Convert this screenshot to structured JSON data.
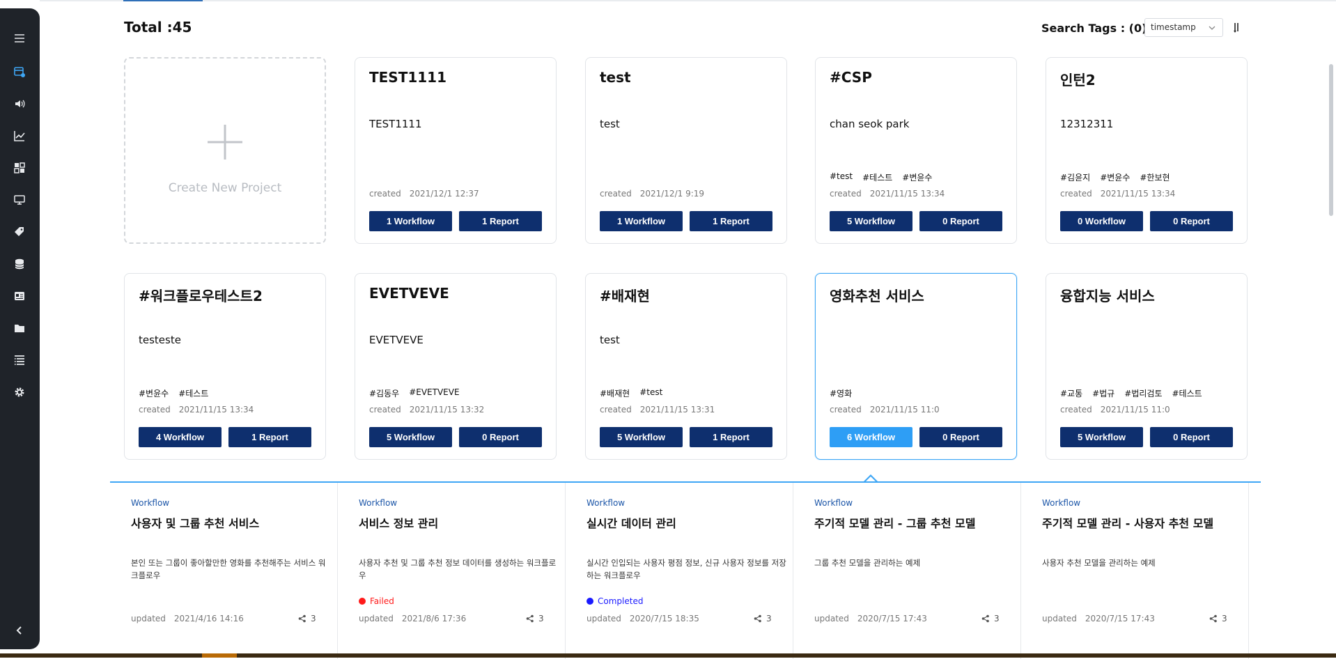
{
  "header": {
    "total_label": "Total :45",
    "search_tags_label": "Search Tags : (0)",
    "sort_value": "timestamp"
  },
  "create_card": {
    "label": "Create New Project"
  },
  "projects": [
    {
      "title": "TEST1111",
      "desc": "TEST1111",
      "tags": [],
      "created_label": "created",
      "created": "2021/12/1 12:37",
      "workflow_btn": "1 Workflow",
      "report_btn": "1 Report"
    },
    {
      "title": "test",
      "desc": "test",
      "tags": [],
      "created_label": "created",
      "created": "2021/12/1 9:19",
      "workflow_btn": "1 Workflow",
      "report_btn": "1 Report"
    },
    {
      "title": "#CSP",
      "desc": "chan seok park",
      "tags": [
        "#test",
        "#테스트",
        "#변윤수"
      ],
      "created_label": "created",
      "created": "2021/11/15 13:34",
      "workflow_btn": "5 Workflow",
      "report_btn": "0 Report"
    },
    {
      "title": "인턴2",
      "desc": "12312311",
      "tags": [
        "#김윤지",
        "#변윤수",
        "#한보현"
      ],
      "created_label": "created",
      "created": "2021/11/15 13:34",
      "workflow_btn": "0 Workflow",
      "report_btn": "0 Report"
    },
    {
      "title": "#워크플로우테스트2",
      "desc": "testeste",
      "tags": [
        "#변윤수",
        "#테스트"
      ],
      "created_label": "created",
      "created": "2021/11/15 13:34",
      "workflow_btn": "4 Workflow",
      "report_btn": "1 Report"
    },
    {
      "title": "EVETVEVE",
      "desc": "EVETVEVE",
      "tags": [
        "#김동우",
        "#EVETVEVE"
      ],
      "created_label": "created",
      "created": "2021/11/15 13:32",
      "workflow_btn": "5 Workflow",
      "report_btn": "0 Report"
    },
    {
      "title": "#배재현",
      "desc": "test",
      "tags": [
        "#배재현",
        "#test"
      ],
      "created_label": "created",
      "created": "2021/11/15 13:31",
      "workflow_btn": "5 Workflow",
      "report_btn": "1 Report"
    },
    {
      "title": "영화추천 서비스",
      "desc": "",
      "tags": [
        "#영화"
      ],
      "created_label": "created",
      "created": "2021/11/15 11:0",
      "workflow_btn": "6 Workflow",
      "report_btn": "0 Report"
    },
    {
      "title": "융합지능 서비스",
      "desc": "",
      "tags": [
        "#교통",
        "#법규",
        "#법리검토",
        "#테스트"
      ],
      "created_label": "created",
      "created": "2021/11/15 11:0",
      "workflow_btn": "5 Workflow",
      "report_btn": "0 Report"
    }
  ],
  "workflows": [
    {
      "kind": "Workflow",
      "name": "사용자 및 그룹 추천 서비스",
      "desc": "본인 또는 그룹이 좋아할만한 영화를 추천해주는 서비스 워크플로우",
      "status": "",
      "status_color": "",
      "updated_label": "updated",
      "updated": "2021/4/16 14:16",
      "shares": "3"
    },
    {
      "kind": "Workflow",
      "name": "서비스 정보 관리",
      "desc": "사용자 추천 및 그룹 추천 정보 데이터를 생성하는 워크플로우",
      "status": "Failed",
      "status_color": "#ff1a1a",
      "updated_label": "updated",
      "updated": "2021/8/6 17:36",
      "shares": "3"
    },
    {
      "kind": "Workflow",
      "name": "실시간 데이터 관리",
      "desc": "실시간 인입되는 사용자 평점 정보, 신규 사용자 정보를 저장하는 워크플로우",
      "status": "Completed",
      "status_color": "#1a1aff",
      "updated_label": "updated",
      "updated": "2020/7/15 18:35",
      "shares": "3"
    },
    {
      "kind": "Workflow",
      "name": "주기적 모델 관리 - 그룹 추천 모델",
      "desc": "그룹 추천 모델을 관리하는 예제",
      "status": "",
      "status_color": "",
      "updated_label": "updated",
      "updated": "2020/7/15 17:43",
      "shares": "3"
    },
    {
      "kind": "Workflow",
      "name": "주기적 모델 관리 - 사용자 추천 모델",
      "desc": "사용자 추천 모델을 관리하는 예제",
      "status": "",
      "status_color": "",
      "updated_label": "updated",
      "updated": "2020/7/15 17:43",
      "shares": "3"
    }
  ],
  "colors": {
    "primary_button": "#0e2f6e",
    "active_button": "#2e9ef5",
    "sidebar": "#1f2329",
    "accent": "#3ea6f5"
  }
}
